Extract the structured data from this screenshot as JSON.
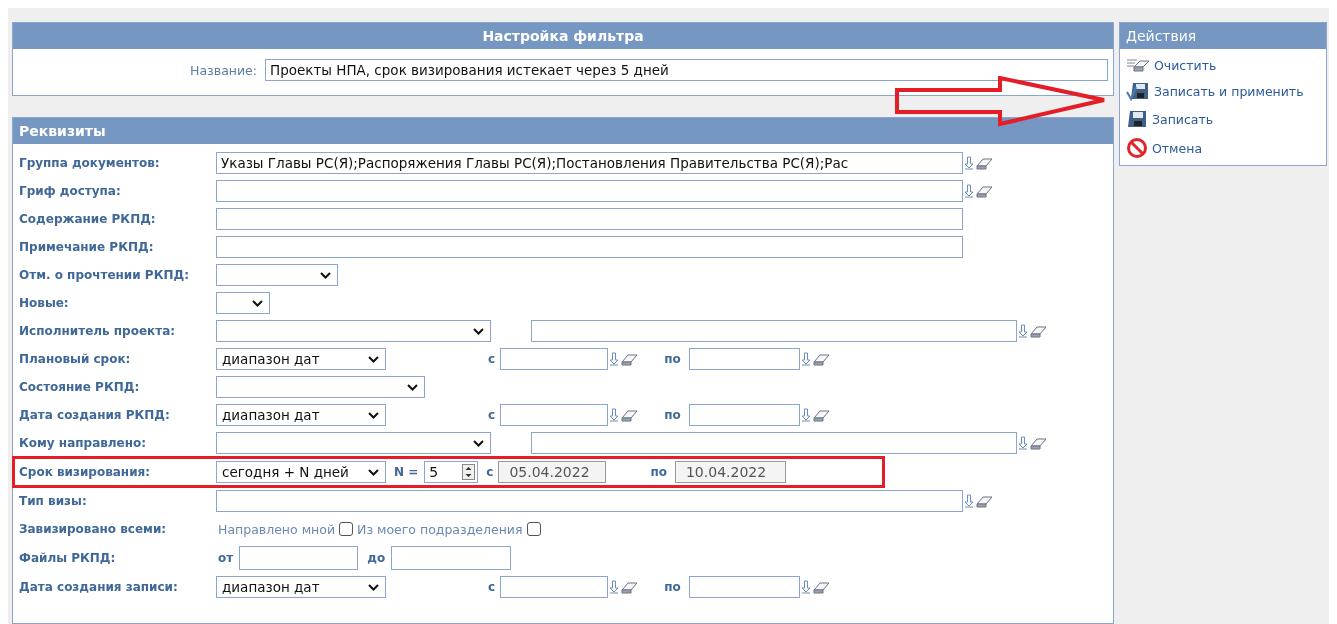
{
  "filter_panel": {
    "title": "Настройка фильтра",
    "name_label": "Название:",
    "name_value": "Проекты НПА, срок визирования истекает через 5 дней"
  },
  "details": {
    "title": "Реквизиты",
    "rows": [
      {
        "kind": "text",
        "label": "Группа документов:",
        "value": "Указы Главы РС(Я);Распоряжения Главы РС(Я);Постановления Правительства РС(Я);Рас",
        "lookup": true
      },
      {
        "kind": "text",
        "label": "Гриф доступа:",
        "lookup": true
      },
      {
        "kind": "text",
        "label": "Содержание РКПД:",
        "lookup": false
      },
      {
        "kind": "text",
        "label": "Примечание РКПД:",
        "lookup": false
      },
      {
        "kind": "select",
        "label": "Отм. о прочтении РКПД:"
      },
      {
        "kind": "select",
        "label": "Новые:"
      },
      {
        "kind": "select_text",
        "label": "Исполнитель проекта:"
      },
      {
        "kind": "date_range",
        "label": "Плановый срок:",
        "mode": "диапазон дат",
        "from_label": "с",
        "to_label": "по"
      },
      {
        "kind": "select",
        "label": "Состояние РКПД:"
      },
      {
        "kind": "date_range",
        "label": "Дата создания РКПД:",
        "mode": "диапазон дат",
        "from_label": "с",
        "to_label": "по"
      },
      {
        "kind": "select_text",
        "label": "Кому направлено:"
      },
      {
        "kind": "n_days",
        "label": "Срок визирования:",
        "mode": "сегодня + N дней",
        "n_label": "N =",
        "n_value": "5",
        "from_label": "с",
        "from_value": "05.04.2022",
        "to_label": "по",
        "to_value": "10.04.2022",
        "highlighted": true
      },
      {
        "kind": "text",
        "label": "Тип визы:",
        "lookup": true
      },
      {
        "kind": "checks",
        "label": "Завизировано всеми:",
        "options": [
          {
            "label": "Направлено мной",
            "checked": false
          },
          {
            "label": "Из моего подразделения",
            "checked": false
          }
        ]
      },
      {
        "kind": "files",
        "label": "Файлы РКПД:",
        "from_label": "от",
        "to_label": "до"
      },
      {
        "kind": "date_range",
        "label": "Дата создания записи:",
        "mode": "диапазон дат",
        "from_label": "с",
        "to_label": "по"
      }
    ]
  },
  "actions": {
    "title": "Действия",
    "items": [
      {
        "kind": "clear",
        "label": "Очистить",
        "pointed": false
      },
      {
        "kind": "save_apply",
        "label": "Записать и применить",
        "pointed": true
      },
      {
        "kind": "save",
        "label": "Записать",
        "pointed": false
      },
      {
        "kind": "cancel",
        "label": "Отмена",
        "pointed": false
      }
    ]
  }
}
